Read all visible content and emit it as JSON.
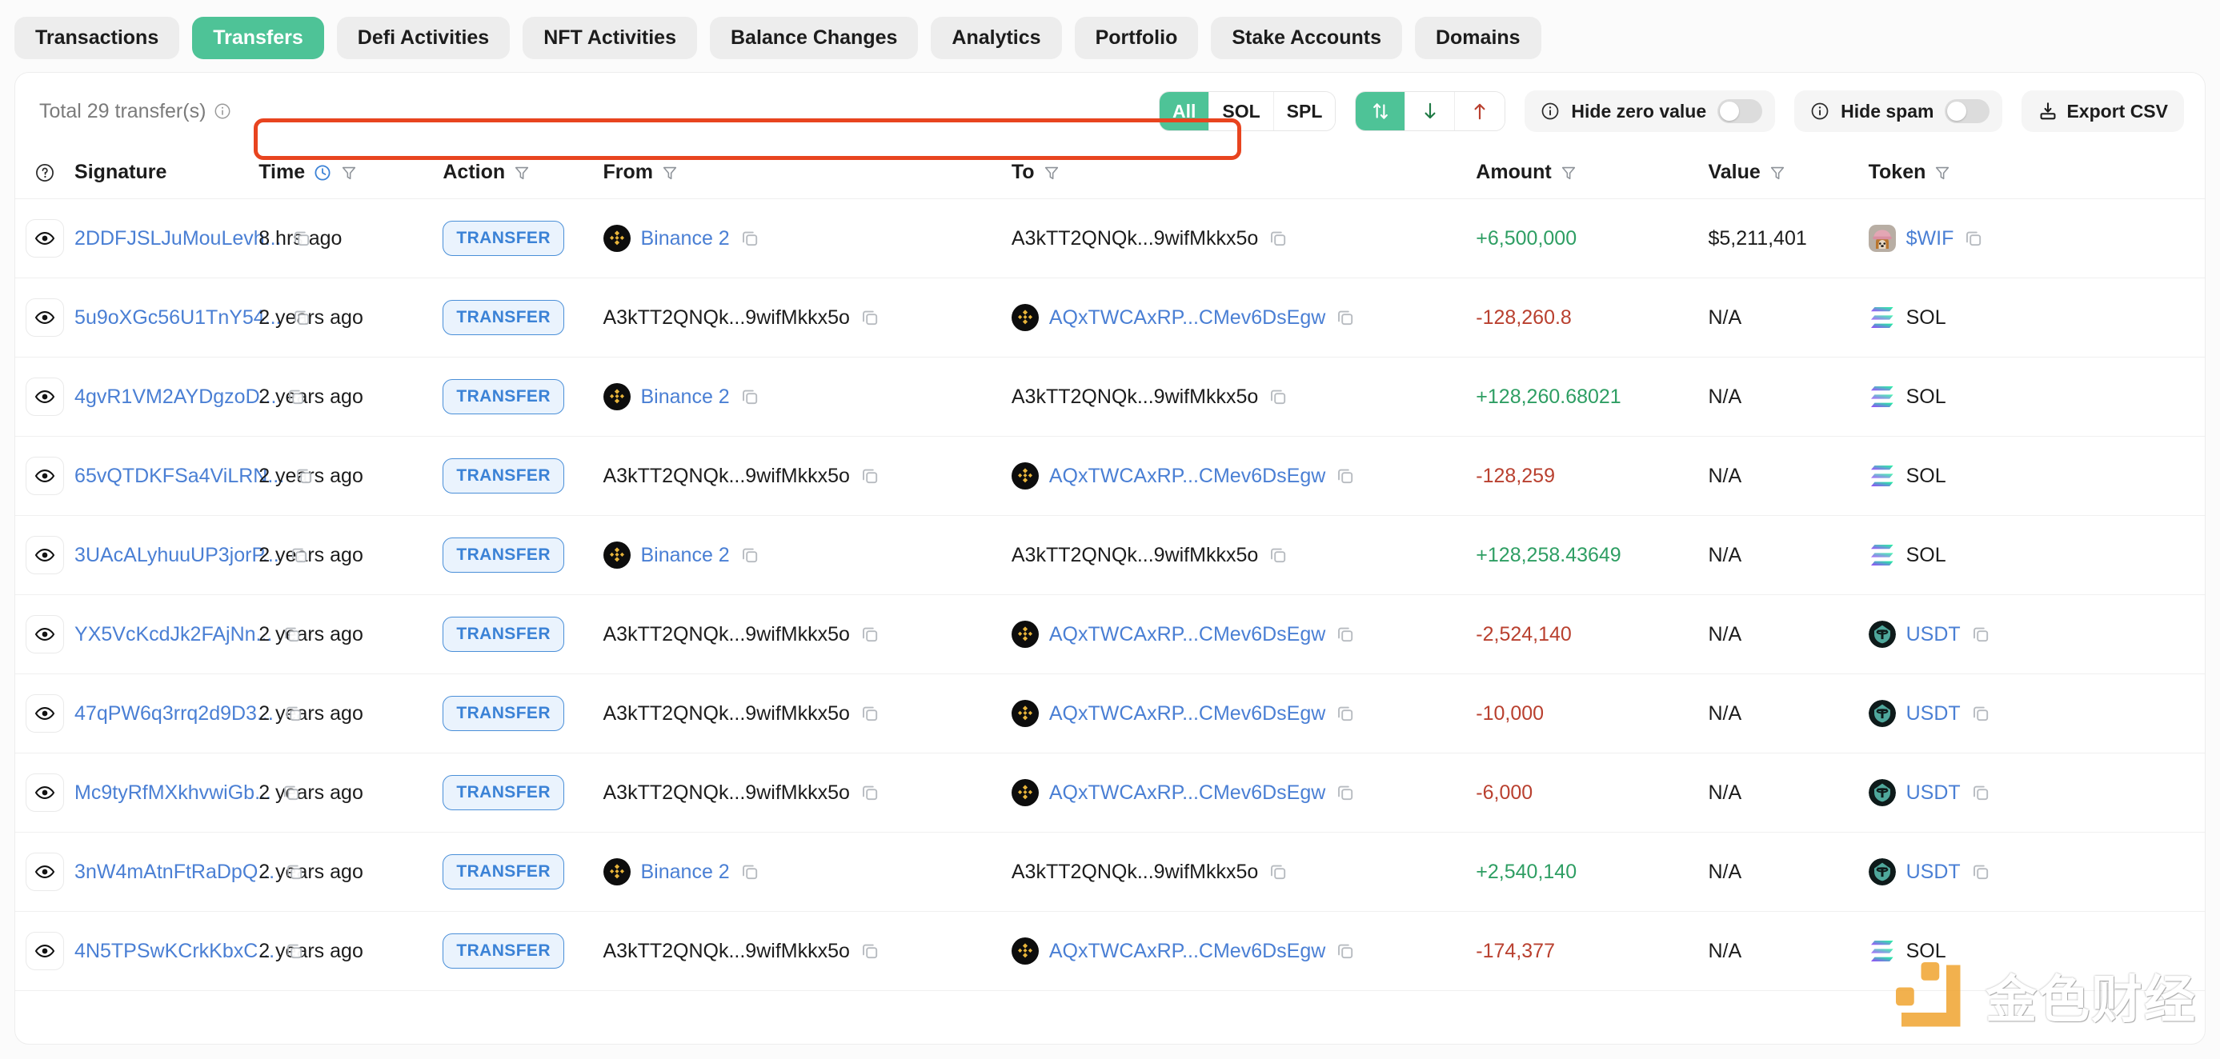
{
  "tabs": [
    {
      "label": "Transactions",
      "active": false
    },
    {
      "label": "Transfers",
      "active": true
    },
    {
      "label": "Defi Activities",
      "active": false
    },
    {
      "label": "NFT Activities",
      "active": false
    },
    {
      "label": "Balance Changes",
      "active": false
    },
    {
      "label": "Analytics",
      "active": false
    },
    {
      "label": "Portfolio",
      "active": false
    },
    {
      "label": "Stake Accounts",
      "active": false
    },
    {
      "label": "Domains",
      "active": false
    }
  ],
  "toolbar": {
    "total_label": "Total 29 transfer(s)",
    "info_icon": "info-circle-icon",
    "token_filter": [
      {
        "label": "All",
        "active": true
      },
      {
        "label": "SOL",
        "active": false
      },
      {
        "label": "SPL",
        "active": false
      }
    ],
    "sort_group": [
      {
        "icon": "sort-updown-icon",
        "active": true
      },
      {
        "icon": "arrow-down-icon",
        "active": false
      },
      {
        "icon": "arrow-up-icon",
        "active": false
      }
    ],
    "hide_zero_value": {
      "label": "Hide zero value",
      "enabled": false
    },
    "hide_spam": {
      "label": "Hide spam",
      "enabled": false
    },
    "export_csv": {
      "label": "Export CSV",
      "icon": "download-icon"
    }
  },
  "table": {
    "headers": [
      {
        "label": "",
        "icon": "help-circle-icon",
        "filter": false
      },
      {
        "label": "Signature",
        "filter": false
      },
      {
        "label": "Time",
        "clock": true,
        "filter": true
      },
      {
        "label": "Action",
        "filter": true
      },
      {
        "label": "From",
        "filter": true
      },
      {
        "label": "To",
        "filter": true
      },
      {
        "label": "Amount",
        "filter": true
      },
      {
        "label": "Value",
        "filter": true
      },
      {
        "label": "Token",
        "filter": true
      }
    ],
    "rows": [
      {
        "signature": "2DDFJSLJuMouLevh...",
        "time": "8 hrs ago",
        "action": "TRANSFER",
        "from": {
          "text": "Binance 2",
          "icon": "binance-icon",
          "link": true
        },
        "to": {
          "text": "A3kTT2QNQk...9wifMkkx5o",
          "icon": null,
          "link": false
        },
        "amount": "+6,500,000",
        "amount_sign": "pos",
        "value": "$5,211,401",
        "token": {
          "symbol": "$WIF",
          "icon": "wif-dog-icon",
          "link": true,
          "copy": true
        },
        "highlighted": true
      },
      {
        "signature": "5u9oXGc56U1TnY54...",
        "time": "2 years ago",
        "action": "TRANSFER",
        "from": {
          "text": "A3kTT2QNQk...9wifMkkx5o",
          "icon": null,
          "link": false
        },
        "to": {
          "text": "AQxTWCAxRP...CMev6DsEgw",
          "icon": "binance-icon",
          "link": true
        },
        "amount": "-128,260.8",
        "amount_sign": "neg",
        "value": "N/A",
        "token": {
          "symbol": "SOL",
          "icon": "solana-icon",
          "link": false,
          "copy": false
        },
        "highlighted": false
      },
      {
        "signature": "4gvR1VM2AYDgzoD...",
        "time": "2 years ago",
        "action": "TRANSFER",
        "from": {
          "text": "Binance 2",
          "icon": "binance-icon",
          "link": true
        },
        "to": {
          "text": "A3kTT2QNQk...9wifMkkx5o",
          "icon": null,
          "link": false
        },
        "amount": "+128,260.68021",
        "amount_sign": "pos",
        "value": "N/A",
        "token": {
          "symbol": "SOL",
          "icon": "solana-icon",
          "link": false,
          "copy": false
        },
        "highlighted": false
      },
      {
        "signature": "65vQTDKFSa4ViLRN...",
        "time": "2 years ago",
        "action": "TRANSFER",
        "from": {
          "text": "A3kTT2QNQk...9wifMkkx5o",
          "icon": null,
          "link": false
        },
        "to": {
          "text": "AQxTWCAxRP...CMev6DsEgw",
          "icon": "binance-icon",
          "link": true
        },
        "amount": "-128,259",
        "amount_sign": "neg",
        "value": "N/A",
        "token": {
          "symbol": "SOL",
          "icon": "solana-icon",
          "link": false,
          "copy": false
        },
        "highlighted": false
      },
      {
        "signature": "3UAcALyhuuUP3jorP...",
        "time": "2 years ago",
        "action": "TRANSFER",
        "from": {
          "text": "Binance 2",
          "icon": "binance-icon",
          "link": true
        },
        "to": {
          "text": "A3kTT2QNQk...9wifMkkx5o",
          "icon": null,
          "link": false
        },
        "amount": "+128,258.43649",
        "amount_sign": "pos",
        "value": "N/A",
        "token": {
          "symbol": "SOL",
          "icon": "solana-icon",
          "link": false,
          "copy": false
        },
        "highlighted": false
      },
      {
        "signature": "YX5VcKcdJk2FAjNn...",
        "time": "2 years ago",
        "action": "TRANSFER",
        "from": {
          "text": "A3kTT2QNQk...9wifMkkx5o",
          "icon": null,
          "link": false
        },
        "to": {
          "text": "AQxTWCAxRP...CMev6DsEgw",
          "icon": "binance-icon",
          "link": true
        },
        "amount": "-2,524,140",
        "amount_sign": "neg",
        "value": "N/A",
        "token": {
          "symbol": "USDT",
          "icon": "tether-icon",
          "link": true,
          "copy": true
        },
        "highlighted": false
      },
      {
        "signature": "47qPW6q3rrq2d9D3...",
        "time": "2 years ago",
        "action": "TRANSFER",
        "from": {
          "text": "A3kTT2QNQk...9wifMkkx5o",
          "icon": null,
          "link": false
        },
        "to": {
          "text": "AQxTWCAxRP...CMev6DsEgw",
          "icon": "binance-icon",
          "link": true
        },
        "amount": "-10,000",
        "amount_sign": "neg",
        "value": "N/A",
        "token": {
          "symbol": "USDT",
          "icon": "tether-icon",
          "link": true,
          "copy": true
        },
        "highlighted": false
      },
      {
        "signature": "Mc9tyRfMXkhvwiGb...",
        "time": "2 years ago",
        "action": "TRANSFER",
        "from": {
          "text": "A3kTT2QNQk...9wifMkkx5o",
          "icon": null,
          "link": false
        },
        "to": {
          "text": "AQxTWCAxRP...CMev6DsEgw",
          "icon": "binance-icon",
          "link": true
        },
        "amount": "-6,000",
        "amount_sign": "neg",
        "value": "N/A",
        "token": {
          "symbol": "USDT",
          "icon": "tether-icon",
          "link": true,
          "copy": true
        },
        "highlighted": false
      },
      {
        "signature": "3nW4mAtnFtRaDpQ...",
        "time": "2 years ago",
        "action": "TRANSFER",
        "from": {
          "text": "Binance 2",
          "icon": "binance-icon",
          "link": true
        },
        "to": {
          "text": "A3kTT2QNQk...9wifMkkx5o",
          "icon": null,
          "link": false
        },
        "amount": "+2,540,140",
        "amount_sign": "pos",
        "value": "N/A",
        "token": {
          "symbol": "USDT",
          "icon": "tether-icon",
          "link": true,
          "copy": true
        },
        "highlighted": false
      },
      {
        "signature": "4N5TPSwKCrkKbxC...",
        "time": "2 years ago",
        "action": "TRANSFER",
        "from": {
          "text": "A3kTT2QNQk...9wifMkkx5o",
          "icon": null,
          "link": false
        },
        "to": {
          "text": "AQxTWCAxRP...CMev6DsEgw",
          "icon": "binance-icon",
          "link": true
        },
        "amount": "-174,377",
        "amount_sign": "neg",
        "value": "N/A",
        "token": {
          "symbol": "SOL",
          "icon": "solana-icon",
          "link": false,
          "copy": false
        },
        "highlighted": false
      }
    ]
  },
  "watermark": {
    "text": "金色财经"
  },
  "colors": {
    "accent_green": "#4ec397",
    "link_blue": "#4a7fd4",
    "badge_blue": "#3b82d6",
    "positive": "#2e9e63",
    "negative": "#b9402f",
    "highlight_red": "#e8441f",
    "watermark_orange": "#f0a028"
  }
}
